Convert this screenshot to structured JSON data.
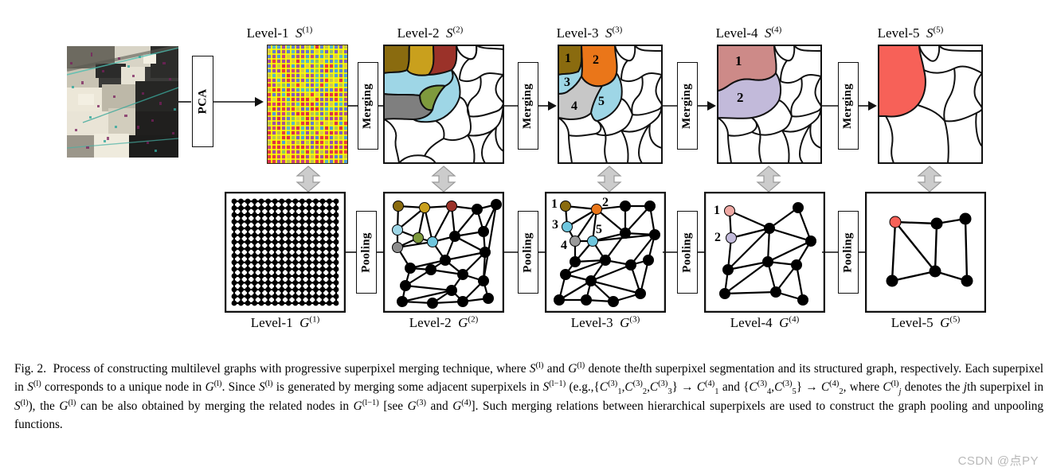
{
  "figure": {
    "number": "Fig. 2.",
    "top_row": [
      {
        "id": "source-image",
        "label_level": "",
        "label_sym": "",
        "has_label": false
      },
      {
        "id": "level1-superpixel",
        "label_level": "Level-1",
        "label_sym": "S",
        "label_sup": "(1)"
      },
      {
        "id": "level2-superpixel",
        "label_level": "Level-2",
        "label_sym": "S",
        "label_sup": "(2)"
      },
      {
        "id": "level3-superpixel",
        "label_level": "Level-3",
        "label_sym": "S",
        "label_sup": "(3)"
      },
      {
        "id": "level4-superpixel",
        "label_level": "Level-4",
        "label_sym": "S",
        "label_sup": "(4)"
      },
      {
        "id": "level5-superpixel",
        "label_level": "Level-5",
        "label_sym": "S",
        "label_sup": "(5)"
      }
    ],
    "bottom_row": [
      {
        "id": "level1-graph",
        "label_level": "Level-1",
        "label_sym": "G",
        "label_sup": "(1)"
      },
      {
        "id": "level2-graph",
        "label_level": "Level-2",
        "label_sym": "G",
        "label_sup": "(2)"
      },
      {
        "id": "level3-graph",
        "label_level": "Level-3",
        "label_sym": "G",
        "label_sup": "(3)"
      },
      {
        "id": "level4-graph",
        "label_level": "Level-4",
        "label_sym": "G",
        "label_sup": "(4)"
      },
      {
        "id": "level5-graph",
        "label_level": "Level-5",
        "label_sym": "G",
        "label_sup": "(5)"
      }
    ],
    "process_boxes": {
      "pca": "PCA",
      "merging": "Merging",
      "pooling": "Pooling"
    },
    "region_numbers": {
      "level3": [
        "1",
        "2",
        "3",
        "4",
        "5"
      ],
      "level4": [
        "1",
        "2"
      ],
      "level3_graph": [
        "1",
        "2",
        "3",
        "4",
        "5"
      ],
      "level4_graph": [
        "1",
        "2"
      ]
    },
    "colors": {
      "dark_olive": "#8a6b0f",
      "golden": "#c9a01d",
      "dark_red": "#9b3229",
      "light_blue": "#9ed6e6",
      "olive_green": "#7e9a3d",
      "gray": "#7f7f7f",
      "orange": "#ea7619",
      "light_gray": "#c7c7c7",
      "salmon": "#cd8a88",
      "lavender": "#c2bada",
      "red": "#f76158",
      "grid_yellow": "#ffff00",
      "arrow_gray": "#cccccc",
      "node_black": "#000000",
      "outline": "#111111"
    }
  },
  "caption": {
    "number": "Fig. 2.",
    "p1": "Process of constructing multilevel graphs with progressive superpixel merging technique, where",
    "p2": "and",
    "p3": "denote the",
    "p4": "th superpixel segmentation and its structured graph, respectively. Each superpixel in",
    "p5": "corresponds to a unique node in",
    "p6": ". Since",
    "p7": "is generated by merging some adjacent superpixels in",
    "p8": "(e.g.,",
    "p9": "and",
    "p10": ", where",
    "p11": "denotes the",
    "p12": "th  superpixel in",
    "p13": "), the",
    "p14": "can be also obtained by merging the related nodes in",
    "p15": "[see",
    "p16": "and",
    "p17": "]. Such merging relations between hierarchical superpixels are used to construct the graph pooling and unpooling functions.",
    "sym_S": "S",
    "sym_G": "G",
    "sym_C": "C",
    "sup_l": "(l)",
    "sup_l1": "(l−1)",
    "sup_3": "(3)",
    "sup_4": "(4)",
    "italic_l": "l",
    "italic_j": "j",
    "arrow": "→",
    "brace_open": "{",
    "brace_close": "}"
  },
  "watermark": "CSDN @点PY"
}
